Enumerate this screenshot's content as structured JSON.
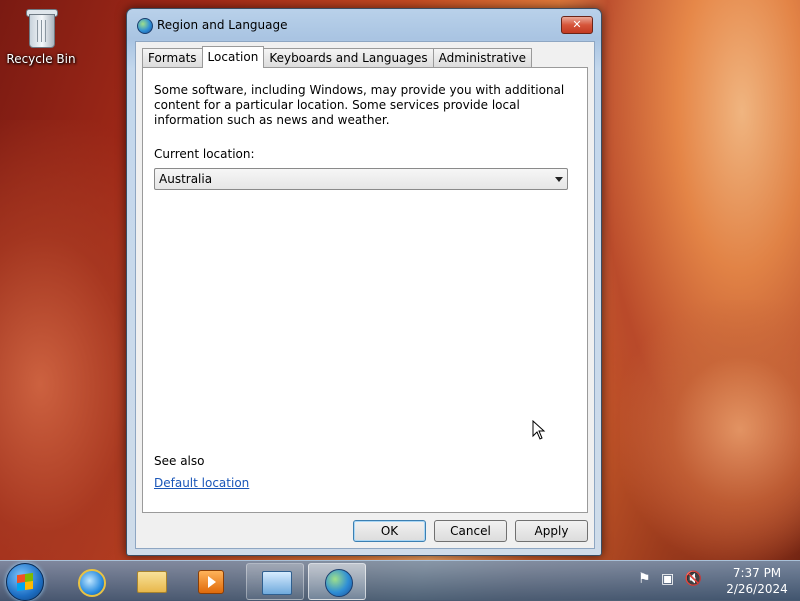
{
  "desktop": {
    "icons": [
      {
        "label": "Recycle Bin",
        "icon": "recycle-bin-icon"
      }
    ]
  },
  "dialog": {
    "title": "Region and Language",
    "close_glyph": "✕",
    "tabs": [
      {
        "label": "Formats",
        "active": false
      },
      {
        "label": "Location",
        "active": true
      },
      {
        "label": "Keyboards and Languages",
        "active": false
      },
      {
        "label": "Administrative",
        "active": false
      }
    ],
    "location": {
      "description": "Some software, including Windows, may provide you with additional content for a particular location. Some services provide local information such as news and weather.",
      "current_location_label": "Current location:",
      "selected_value": "Australia",
      "see_also_label": "See also",
      "default_location_link": "Default location"
    },
    "buttons": {
      "ok": "OK",
      "cancel": "Cancel",
      "apply": "Apply"
    }
  },
  "taskbar": {
    "items": [
      {
        "icon": "internet-explorer-icon",
        "state": "pinned"
      },
      {
        "icon": "file-explorer-icon",
        "state": "pinned"
      },
      {
        "icon": "media-player-icon",
        "state": "pinned"
      },
      {
        "icon": "control-panel-icon",
        "state": "open"
      },
      {
        "icon": "region-language-globe-icon",
        "state": "active"
      }
    ],
    "tray": {
      "flag_glyph": "⚑",
      "network_glyph": "▣",
      "volume_glyph": "🔇",
      "time": "7:37 PM",
      "date": "2/26/2024"
    }
  },
  "colors": {
    "link": "#1a56b8",
    "close_button": "#d6553a",
    "default_button_border": "#3c7fb1"
  }
}
